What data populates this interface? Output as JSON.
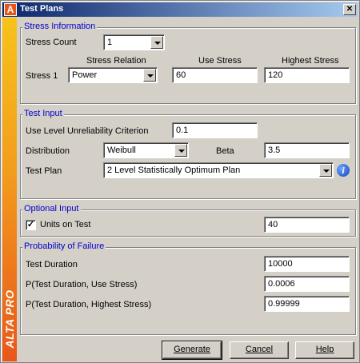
{
  "window": {
    "title": "Test Plans",
    "app_icon_letter": "A",
    "close_glyph": "✕"
  },
  "sidebar": {
    "brand": "ALTA PRO"
  },
  "stress_info": {
    "legend": "Stress Information",
    "stress_count_label": "Stress Count",
    "stress_count_value": "1",
    "col_stress_relation": "Stress Relation",
    "col_use_stress": "Use Stress",
    "col_highest_stress": "Highest Stress",
    "row_label": "Stress 1",
    "relation_value": "Power",
    "use_stress_value": "60",
    "highest_stress_value": "120"
  },
  "test_input": {
    "legend": "Test Input",
    "criterion_label": "Use Level Unreliability Criterion",
    "criterion_value": "0.1",
    "distribution_label": "Distribution",
    "distribution_value": "Weibull",
    "beta_label": "Beta",
    "beta_value": "3.5",
    "plan_label": "Test Plan",
    "plan_value": "2 Level Statistically Optimum Plan",
    "info_glyph": "i"
  },
  "optional_input": {
    "legend": "Optional Input",
    "units_label": "Units on Test",
    "units_checked": true,
    "check_glyph": "✓",
    "units_value": "40"
  },
  "pof": {
    "legend": "Probability of Failure",
    "duration_label": "Test Duration",
    "duration_value": "10000",
    "use_label": "P(Test Duration, Use Stress)",
    "use_value": "0.0006",
    "high_label": "P(Test Duration, Highest Stress)",
    "high_value": "0.99999"
  },
  "buttons": {
    "generate": "Generate",
    "cancel": "Cancel",
    "help": "Help"
  },
  "colors": {
    "legend_text": "#0000cc",
    "title_bar": "#0a246a",
    "brand_bar": "#f39c1d"
  }
}
